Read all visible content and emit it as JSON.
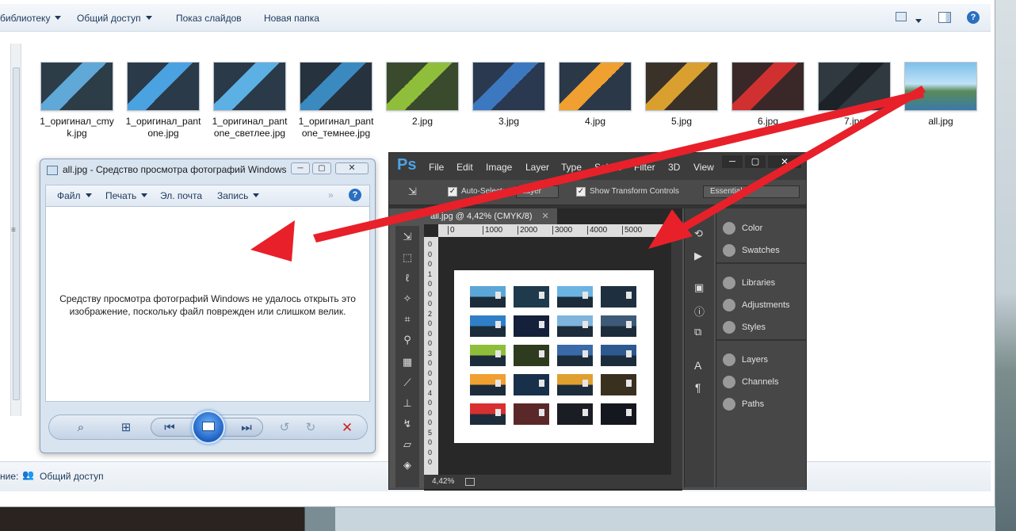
{
  "explorer": {
    "toolbar": {
      "library": "библиотеку",
      "share": "Общий доступ",
      "slideshow": "Показ слайдов",
      "new_folder": "Новая папка"
    },
    "files": [
      {
        "name": "1_оригинал_cmyk.jpg",
        "line1": "1_оригинал_cmy",
        "line2": "k.jpg",
        "color": "#5fa8d8",
        "bg": "#2c3d48"
      },
      {
        "name": "1_оригинал_pantone.jpg",
        "line1": "1_оригинал_pant",
        "line2": "one.jpg",
        "color": "#4aa2e0",
        "bg": "#2a3a48"
      },
      {
        "name": "1_оригинал_pantone_светлее.jpg",
        "line1": "1_оригинал_pant",
        "line2": "one_светлее.jpg",
        "color": "#5cb0e4",
        "bg": "#2a3a48"
      },
      {
        "name": "1_оригинал_pantone_темнее.jpg",
        "line1": "1_оригинал_pant",
        "line2": "one_темнее.jpg",
        "color": "#3a8ac0",
        "bg": "#26323e"
      },
      {
        "name": "2.jpg",
        "line1": "2.jpg",
        "line2": "",
        "color": "#8fbf3a",
        "bg": "#3a4a2c"
      },
      {
        "name": "3.jpg",
        "line1": "3.jpg",
        "line2": "",
        "color": "#3b78c0",
        "bg": "#2a3850"
      },
      {
        "name": "4.jpg",
        "line1": "4.jpg",
        "line2": "",
        "color": "#f0a030",
        "bg": "#2a3848"
      },
      {
        "name": "5.jpg",
        "line1": "5.jpg",
        "line2": "",
        "color": "#d9a030",
        "bg": "#3a3228"
      },
      {
        "name": "6.jpg",
        "line1": "6.jpg",
        "line2": "",
        "color": "#d03030",
        "bg": "#3a2828"
      },
      {
        "name": "7.jpg",
        "line1": "7.jpg",
        "line2": "",
        "color": "#1c2228",
        "bg": "#303840"
      },
      {
        "name": "all.jpg",
        "line1": "all.jpg",
        "line2": "",
        "color": "#6fb3e0",
        "bg": "#4a8a6a"
      }
    ],
    "status": {
      "prefix": "ние:",
      "shared": "Общий доступ"
    }
  },
  "viewer": {
    "title": "all.jpg - Средство просмотра фотографий Windows",
    "menu": {
      "file": "Файл",
      "print": "Печать",
      "email": "Эл. почта",
      "burn": "Запись"
    },
    "message": "Средству просмотра фотографий Windows не удалось открыть это изображение, поскольку файл поврежден или слишком велик."
  },
  "photoshop": {
    "logo": "Ps",
    "menu": [
      "File",
      "Edit",
      "Image",
      "Layer",
      "Type",
      "Select",
      "Filter",
      "3D",
      "View"
    ],
    "options": {
      "auto_select": "Auto-Select:",
      "layer": "Layer",
      "show_transform": "Show Transform Controls",
      "workspace": "Essentials"
    },
    "doc_tab": "all.jpg @ 4,42% (CMYK/8)",
    "ruler_ticks": [
      "0",
      "1000",
      "2000",
      "3000",
      "4000",
      "5000"
    ],
    "ruler_v_digits": [
      "0",
      "0",
      "0",
      "1",
      "0",
      "0",
      "0",
      "2",
      "0",
      "0",
      "0",
      "3",
      "0",
      "0",
      "0",
      "4",
      "0",
      "0",
      "0",
      "5",
      "0",
      "0",
      "0"
    ],
    "zoom": "4,42%",
    "panels": [
      "Color",
      "Swatches",
      "Libraries",
      "Adjustments",
      "Styles",
      "Layers",
      "Channels",
      "Paths"
    ]
  },
  "canvas_cards": [
    [
      "#5aa6d6",
      "#1f3a4c",
      "#6bb4e2",
      "#1e3040"
    ],
    [
      "#2f7fc8",
      "#15203a",
      "#7fb4dd",
      "#3d5a78"
    ],
    [
      "#8fbf3a",
      "#2e3b1e",
      "#3a6aa8",
      "#2c5a90"
    ],
    [
      "#f0a030",
      "#18304a",
      "#e0a030",
      "#3a3020"
    ],
    [
      "#d83030",
      "#5a2828",
      "#1a1e24",
      "#14181e"
    ]
  ]
}
